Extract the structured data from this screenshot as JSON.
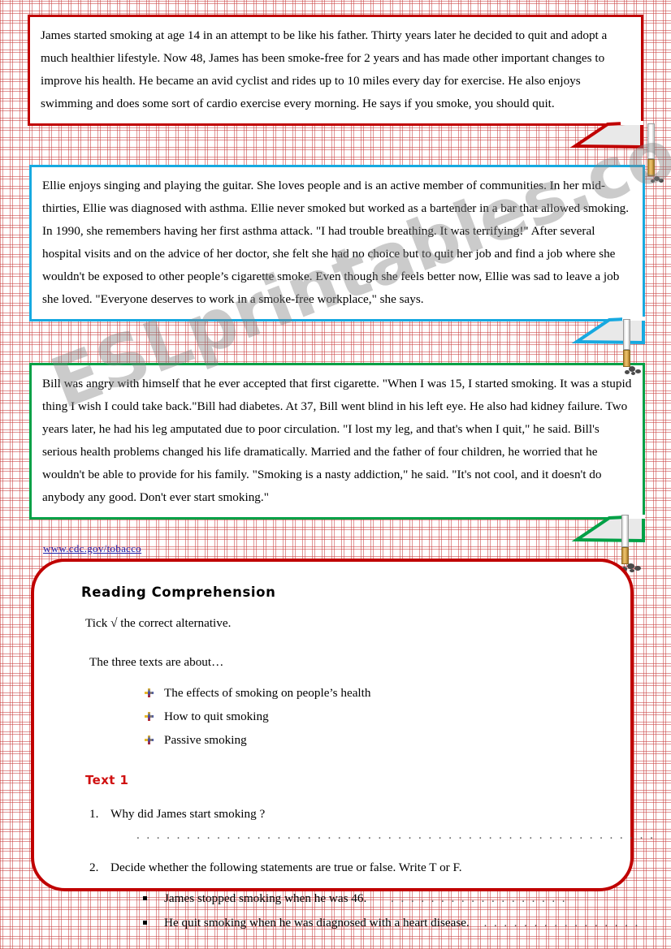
{
  "watermark": "ESLprintables.com",
  "texts": [
    {
      "id": "james",
      "border_color": "#c00000",
      "content": "James started smoking at age 14 in an attempt to be like his father. Thirty years later he decided to quit and adopt a much healthier lifestyle. Now 48, James has been smoke-free for 2 years and has made other important changes to improve his health. He became an avid cyclist and rides up to 10 miles every day for exercise. He also enjoys swimming and does some sort of cardio exercise every morning. He says if you smoke, you should quit."
    },
    {
      "id": "ellie",
      "border_color": "#17a9e0",
      "content": "Ellie enjoys singing and playing the guitar. She loves people and is an active member of communities. In her mid-thirties, Ellie was diagnosed with asthma. Ellie never smoked but worked as a bartender in a bar that allowed smoking. In 1990, she remembers having her first asthma attack. \"I had trouble breathing. It was terrifying!\" After several hospital visits and on the advice of her doctor, she felt she had no choice but to quit her job and find a job where she wouldn't be exposed to other people’s cigarette smoke. Even though she feels better now, Ellie was sad to leave a job she loved. \"Everyone deserves to work in a smoke-free workplace,\" she says."
    },
    {
      "id": "bill",
      "border_color": "#00a046",
      "content": "Bill was angry with himself that he ever accepted that first cigarette. \"When I was 15, I started smoking. It was a stupid thing I wish I could take back.\"Bill had diabetes. At 37, Bill went blind in his left eye. He also had kidney failure. Two years later, he had his leg amputated due to poor circulation.  \"I lost my leg, and that's when I quit,\" he said. Bill's serious health problems changed his life dramatically. Married and the father of four children, he worried that he wouldn't be able to provide for his family. \"Smoking is a nasty addiction,\" he said. \"It's not cool, and it doesn't do anybody any good. Don't ever start smoking.\""
    }
  ],
  "source": {
    "url_label": "www.cdc.gov/tobacco",
    "color": "#2222aa"
  },
  "exercise": {
    "title": "Reading Comprehension",
    "instruction": "Tick √ the correct alternative.",
    "prompt": "The three texts are about…",
    "alternatives": [
      "The effects of smoking on people’s health",
      "How to quit smoking",
      "Passive smoking"
    ],
    "text1_heading": "Text 1",
    "text1_color": "#d01010",
    "questions": [
      {
        "number": "1.",
        "text": "Why did James start smoking ?"
      },
      {
        "number": "2.",
        "text": "Decide whether the following statements are true or false. Write T or F."
      }
    ],
    "answer_line": ". . . . . . . . . . . . . . . . . . . . . . . . . . . . . . . . . . . . . . . . . . . . . . . . . . . . . . . . . . . . . . . . . . . . . . . . . . . . . . . . . .",
    "statements": [
      {
        "text": "James stopped smoking when he was 46.",
        "dots": ". . . . . . . . . . . . . . . . . ."
      },
      {
        "text": "He quit smoking when he was diagnosed with a heart disease.",
        "dots": ". . . . . . . . . . . . . . . ."
      }
    ]
  }
}
